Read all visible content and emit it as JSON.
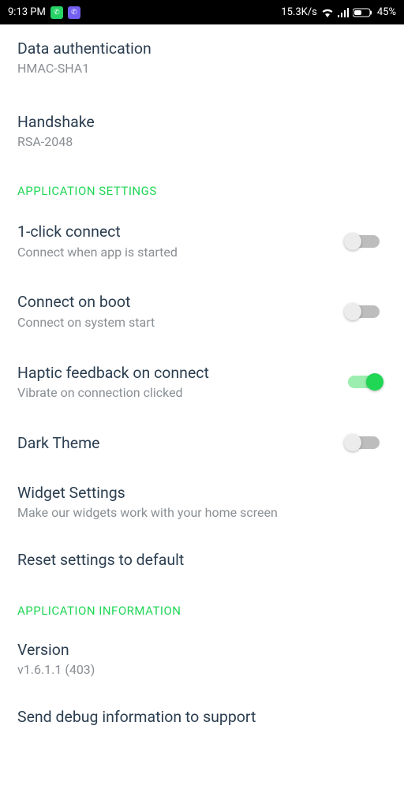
{
  "status": {
    "time": "9:13 PM",
    "net_speed": "15.3K/s",
    "battery_pct": "45%"
  },
  "rows": {
    "data_auth": {
      "title": "Data authentication",
      "sub": "HMAC-SHA1"
    },
    "handshake": {
      "title": "Handshake",
      "sub": "RSA-2048"
    }
  },
  "sections": {
    "app_settings": "APPLICATION SETTINGS",
    "app_info": "APPLICATION INFORMATION"
  },
  "toggles": {
    "one_click": {
      "title": "1-click connect",
      "sub": "Connect when app is started"
    },
    "boot": {
      "title": "Connect on boot",
      "sub": "Connect on system start"
    },
    "haptic": {
      "title": "Haptic feedback on connect",
      "sub": "Vibrate on connection clicked"
    },
    "dark": {
      "title": "Dark Theme"
    }
  },
  "links": {
    "widget": {
      "title": "Widget Settings",
      "sub": "Make our widgets work with your home screen"
    },
    "reset": {
      "title": "Reset settings to default"
    },
    "version": {
      "title": "Version",
      "sub": "v1.6.1.1 (403)"
    },
    "debug": {
      "title": "Send debug information to support"
    }
  }
}
